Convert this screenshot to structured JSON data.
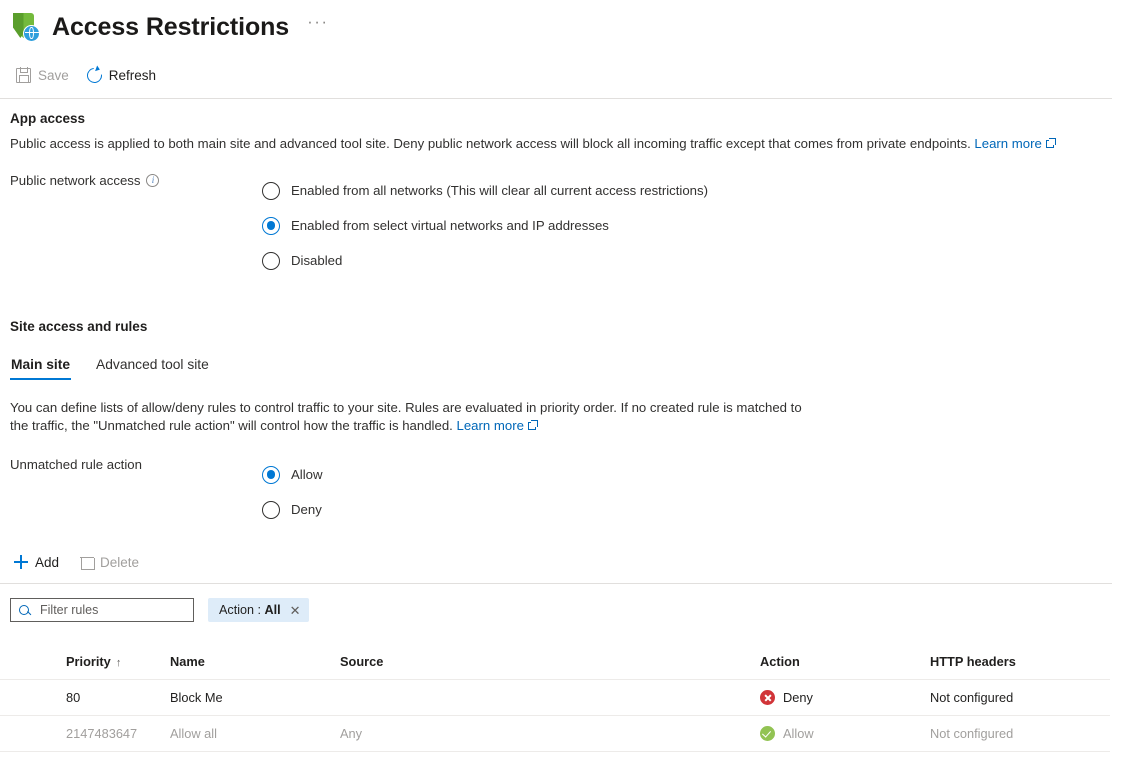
{
  "header": {
    "title": "Access Restrictions",
    "more_label": "···",
    "icon": "shield-globe-icon"
  },
  "commandbar": {
    "save_label": "Save",
    "refresh_label": "Refresh",
    "save_icon": "save-icon",
    "refresh_icon": "refresh-icon"
  },
  "app_access": {
    "section_title": "App access",
    "description_before_link": "Public access is applied to both main site and advanced tool site. Deny public network access will block all incoming traffic except that comes from private endpoints. ",
    "learn_more": "Learn more",
    "field_label": "Public network access",
    "info_icon": "info-icon",
    "options": [
      {
        "label": "Enabled from all networks (This will clear all current access restrictions)",
        "selected": false
      },
      {
        "label": "Enabled from select virtual networks and IP addresses",
        "selected": true
      },
      {
        "label": "Disabled",
        "selected": false
      }
    ]
  },
  "site_access": {
    "section_title": "Site access and rules",
    "tabs": [
      {
        "label": "Main site",
        "active": true
      },
      {
        "label": "Advanced tool site",
        "active": false
      }
    ],
    "description_before_link": "You can define lists of allow/deny rules to control traffic to your site. Rules are evaluated in priority order. If no created rule is matched to the traffic, the \"Unmatched rule action\" will control how the traffic is handled. ",
    "learn_more": "Learn more",
    "unmatched_label": "Unmatched rule action",
    "unmatched_options": [
      {
        "label": "Allow",
        "selected": true
      },
      {
        "label": "Deny",
        "selected": false
      }
    ]
  },
  "rules_toolbar": {
    "add_label": "Add",
    "delete_label": "Delete",
    "add_icon": "plus-icon",
    "delete_icon": "trash-icon",
    "delete_disabled": true
  },
  "filter": {
    "placeholder": "Filter rules",
    "value": "",
    "search_icon": "search-icon",
    "pill_prefix": "Action :",
    "pill_value": "All",
    "pill_close_icon": "close-icon"
  },
  "table": {
    "columns": [
      {
        "key": "priority",
        "label": "Priority",
        "sort": "↑"
      },
      {
        "key": "name",
        "label": "Name"
      },
      {
        "key": "source",
        "label": "Source"
      },
      {
        "key": "action",
        "label": "Action"
      },
      {
        "key": "http_headers",
        "label": "HTTP headers"
      }
    ],
    "rows": [
      {
        "priority": "80",
        "name": "Block Me",
        "source": "",
        "action": "Deny",
        "action_kind": "deny",
        "http_headers": "Not configured",
        "dimmed": false
      },
      {
        "priority": "2147483647",
        "name": "Allow all",
        "source": "Any",
        "action": "Allow",
        "action_kind": "allow",
        "http_headers": "Not configured",
        "dimmed": true
      }
    ]
  },
  "colors": {
    "accent": "#0078d4",
    "link": "#0067b8",
    "deny": "#d13438",
    "allow": "#92c353",
    "pill_bg": "#deecf9"
  }
}
